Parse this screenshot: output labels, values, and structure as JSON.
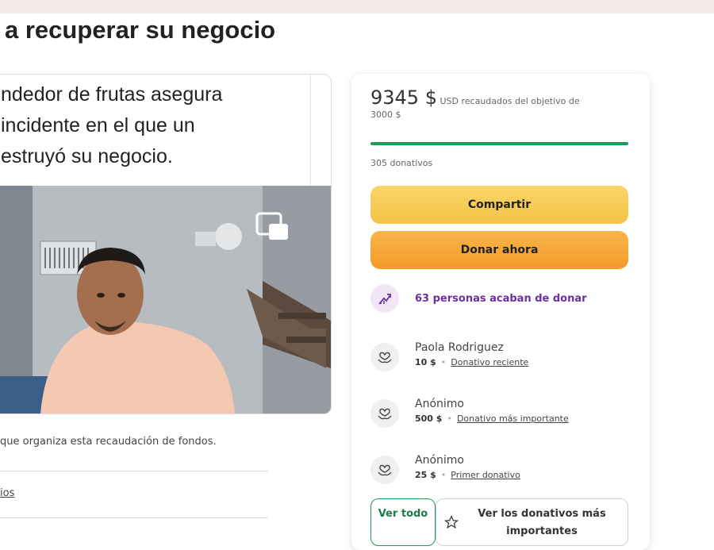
{
  "page": {
    "title": "a recuperar su negocio"
  },
  "media": {
    "caption": "ndedor de frutas asegura\nincidente en el que un\nestruyó su negocio."
  },
  "organizer": {
    "text": "que organiza esta recaudación de fondos.",
    "link": "ios"
  },
  "donation": {
    "raised_amount": "9345 $",
    "raised_desc": "USD recaudados del objetivo de",
    "goal": "3000 $",
    "progress_fraction": 1.0,
    "donation_count": "305 donativos",
    "share_label": "Compartir",
    "donate_label": "Donar ahora",
    "trend_text": "63 personas acaban de donar",
    "donors": [
      {
        "name": "Paola Rodriguez",
        "amount": "10 $",
        "tag": "Donativo reciente"
      },
      {
        "name": "Anónimo",
        "amount": "500 $",
        "tag": "Donativo más importante"
      },
      {
        "name": "Anónimo",
        "amount": "25 $",
        "tag": "Primer donativo"
      }
    ],
    "see_all_label": "Ver todo",
    "top_donations_label": "Ver los donativos más importantes"
  },
  "colors": {
    "accent_green": "#1f9a5a",
    "share_yellow": "#f3c346",
    "donate_orange": "#f49a27",
    "trend_purple": "#6b2fa0"
  },
  "icons": [
    "trending-up-icon",
    "heart-hands-icon",
    "star-icon",
    "expand-icon"
  ]
}
